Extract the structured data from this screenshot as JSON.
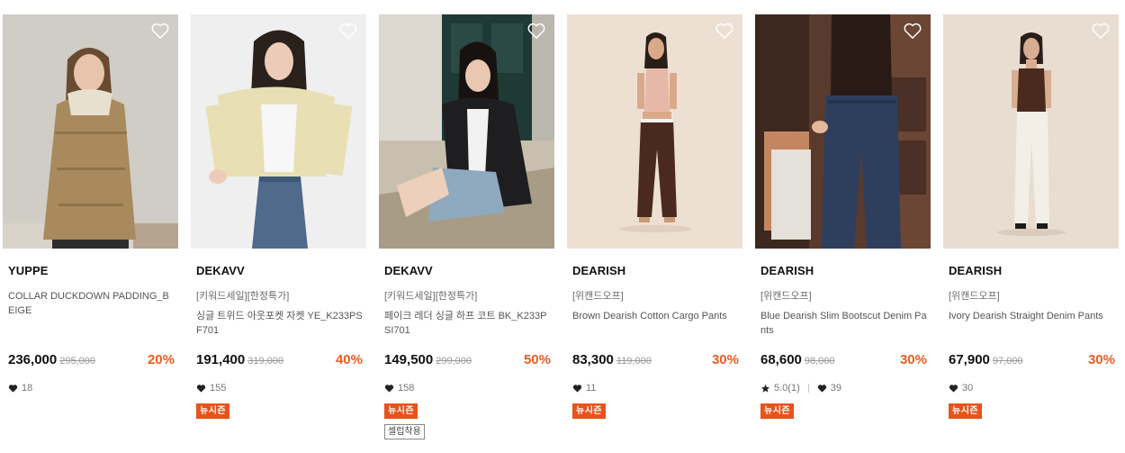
{
  "products": [
    {
      "brand": "YUPPE",
      "promo": "",
      "name": "COLLAR DUCKDOWN PADDING_BEIGE",
      "price": "236,000",
      "original_price": "295,000",
      "discount": "20%",
      "likes": "18",
      "rating": "",
      "badges": []
    },
    {
      "brand": "DEKAVV",
      "promo": "[키워드세일][한정특가]",
      "name": "싱글 트위드 아웃포켓 자켓 YE_K233PSF701",
      "price": "191,400",
      "original_price": "319,000",
      "discount": "40%",
      "likes": "155",
      "rating": "",
      "badges": [
        "뉴시즌"
      ]
    },
    {
      "brand": "DEKAVV",
      "promo": "[키워드세일][한정특가]",
      "name": "페이크 레더 싱글 하프 코트 BK_K233PSI701",
      "price": "149,500",
      "original_price": "299,000",
      "discount": "50%",
      "likes": "158",
      "rating": "",
      "badges": [
        "뉴시즌",
        "셀럽착용"
      ]
    },
    {
      "brand": "DEARISH",
      "promo": "[위캔드오프]",
      "name": "Brown Dearish Cotton Cargo Pants",
      "price": "83,300",
      "original_price": "119,000",
      "discount": "30%",
      "likes": "11",
      "rating": "",
      "badges": [
        "뉴시즌"
      ]
    },
    {
      "brand": "DEARISH",
      "promo": "[위캔드오프]",
      "name": "Blue Dearish Slim Bootscut Denim Pants",
      "price": "68,600",
      "original_price": "98,000",
      "discount": "30%",
      "likes": "39",
      "rating": "5.0(1)",
      "badges": [
        "뉴시즌"
      ]
    },
    {
      "brand": "DEARISH",
      "promo": "[위캔드오프]",
      "name": "Ivory Dearish Straight Denim Pants",
      "price": "67,900",
      "original_price": "97,000",
      "discount": "30%",
      "likes": "30",
      "rating": "",
      "badges": [
        "뉴시즌"
      ]
    }
  ],
  "icons": {
    "wishlist": "heart-outline-icon",
    "likes": "heart-filled-icon",
    "rating": "star-icon"
  },
  "colors": {
    "discount": "#f25a1e",
    "badge_new": "#e8521b",
    "text": "#111111",
    "muted": "#777777"
  }
}
